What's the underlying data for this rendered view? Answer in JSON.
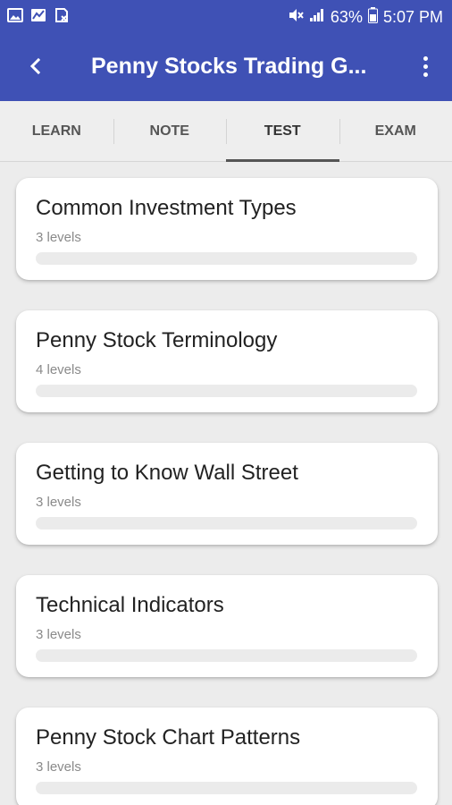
{
  "status_bar": {
    "battery": "63%",
    "time": "5:07 PM"
  },
  "app_bar": {
    "title": "Penny Stocks Trading G..."
  },
  "tabs": [
    {
      "label": "LEARN",
      "active": false
    },
    {
      "label": "NOTE",
      "active": false
    },
    {
      "label": "TEST",
      "active": true
    },
    {
      "label": "EXAM",
      "active": false
    }
  ],
  "cards": [
    {
      "title": "Common Investment Types",
      "subtitle": "3 levels",
      "progress": 0
    },
    {
      "title": "Penny Stock Terminology",
      "subtitle": "4 levels",
      "progress": 0
    },
    {
      "title": "Getting to Know Wall Street",
      "subtitle": "3 levels",
      "progress": 0
    },
    {
      "title": "Technical Indicators",
      "subtitle": "3 levels",
      "progress": 0
    },
    {
      "title": "Penny Stock Chart Patterns",
      "subtitle": "3 levels",
      "progress": 0
    }
  ],
  "colors": {
    "primary": "#3f51b5",
    "background": "#ececec",
    "card": "#ffffff"
  }
}
